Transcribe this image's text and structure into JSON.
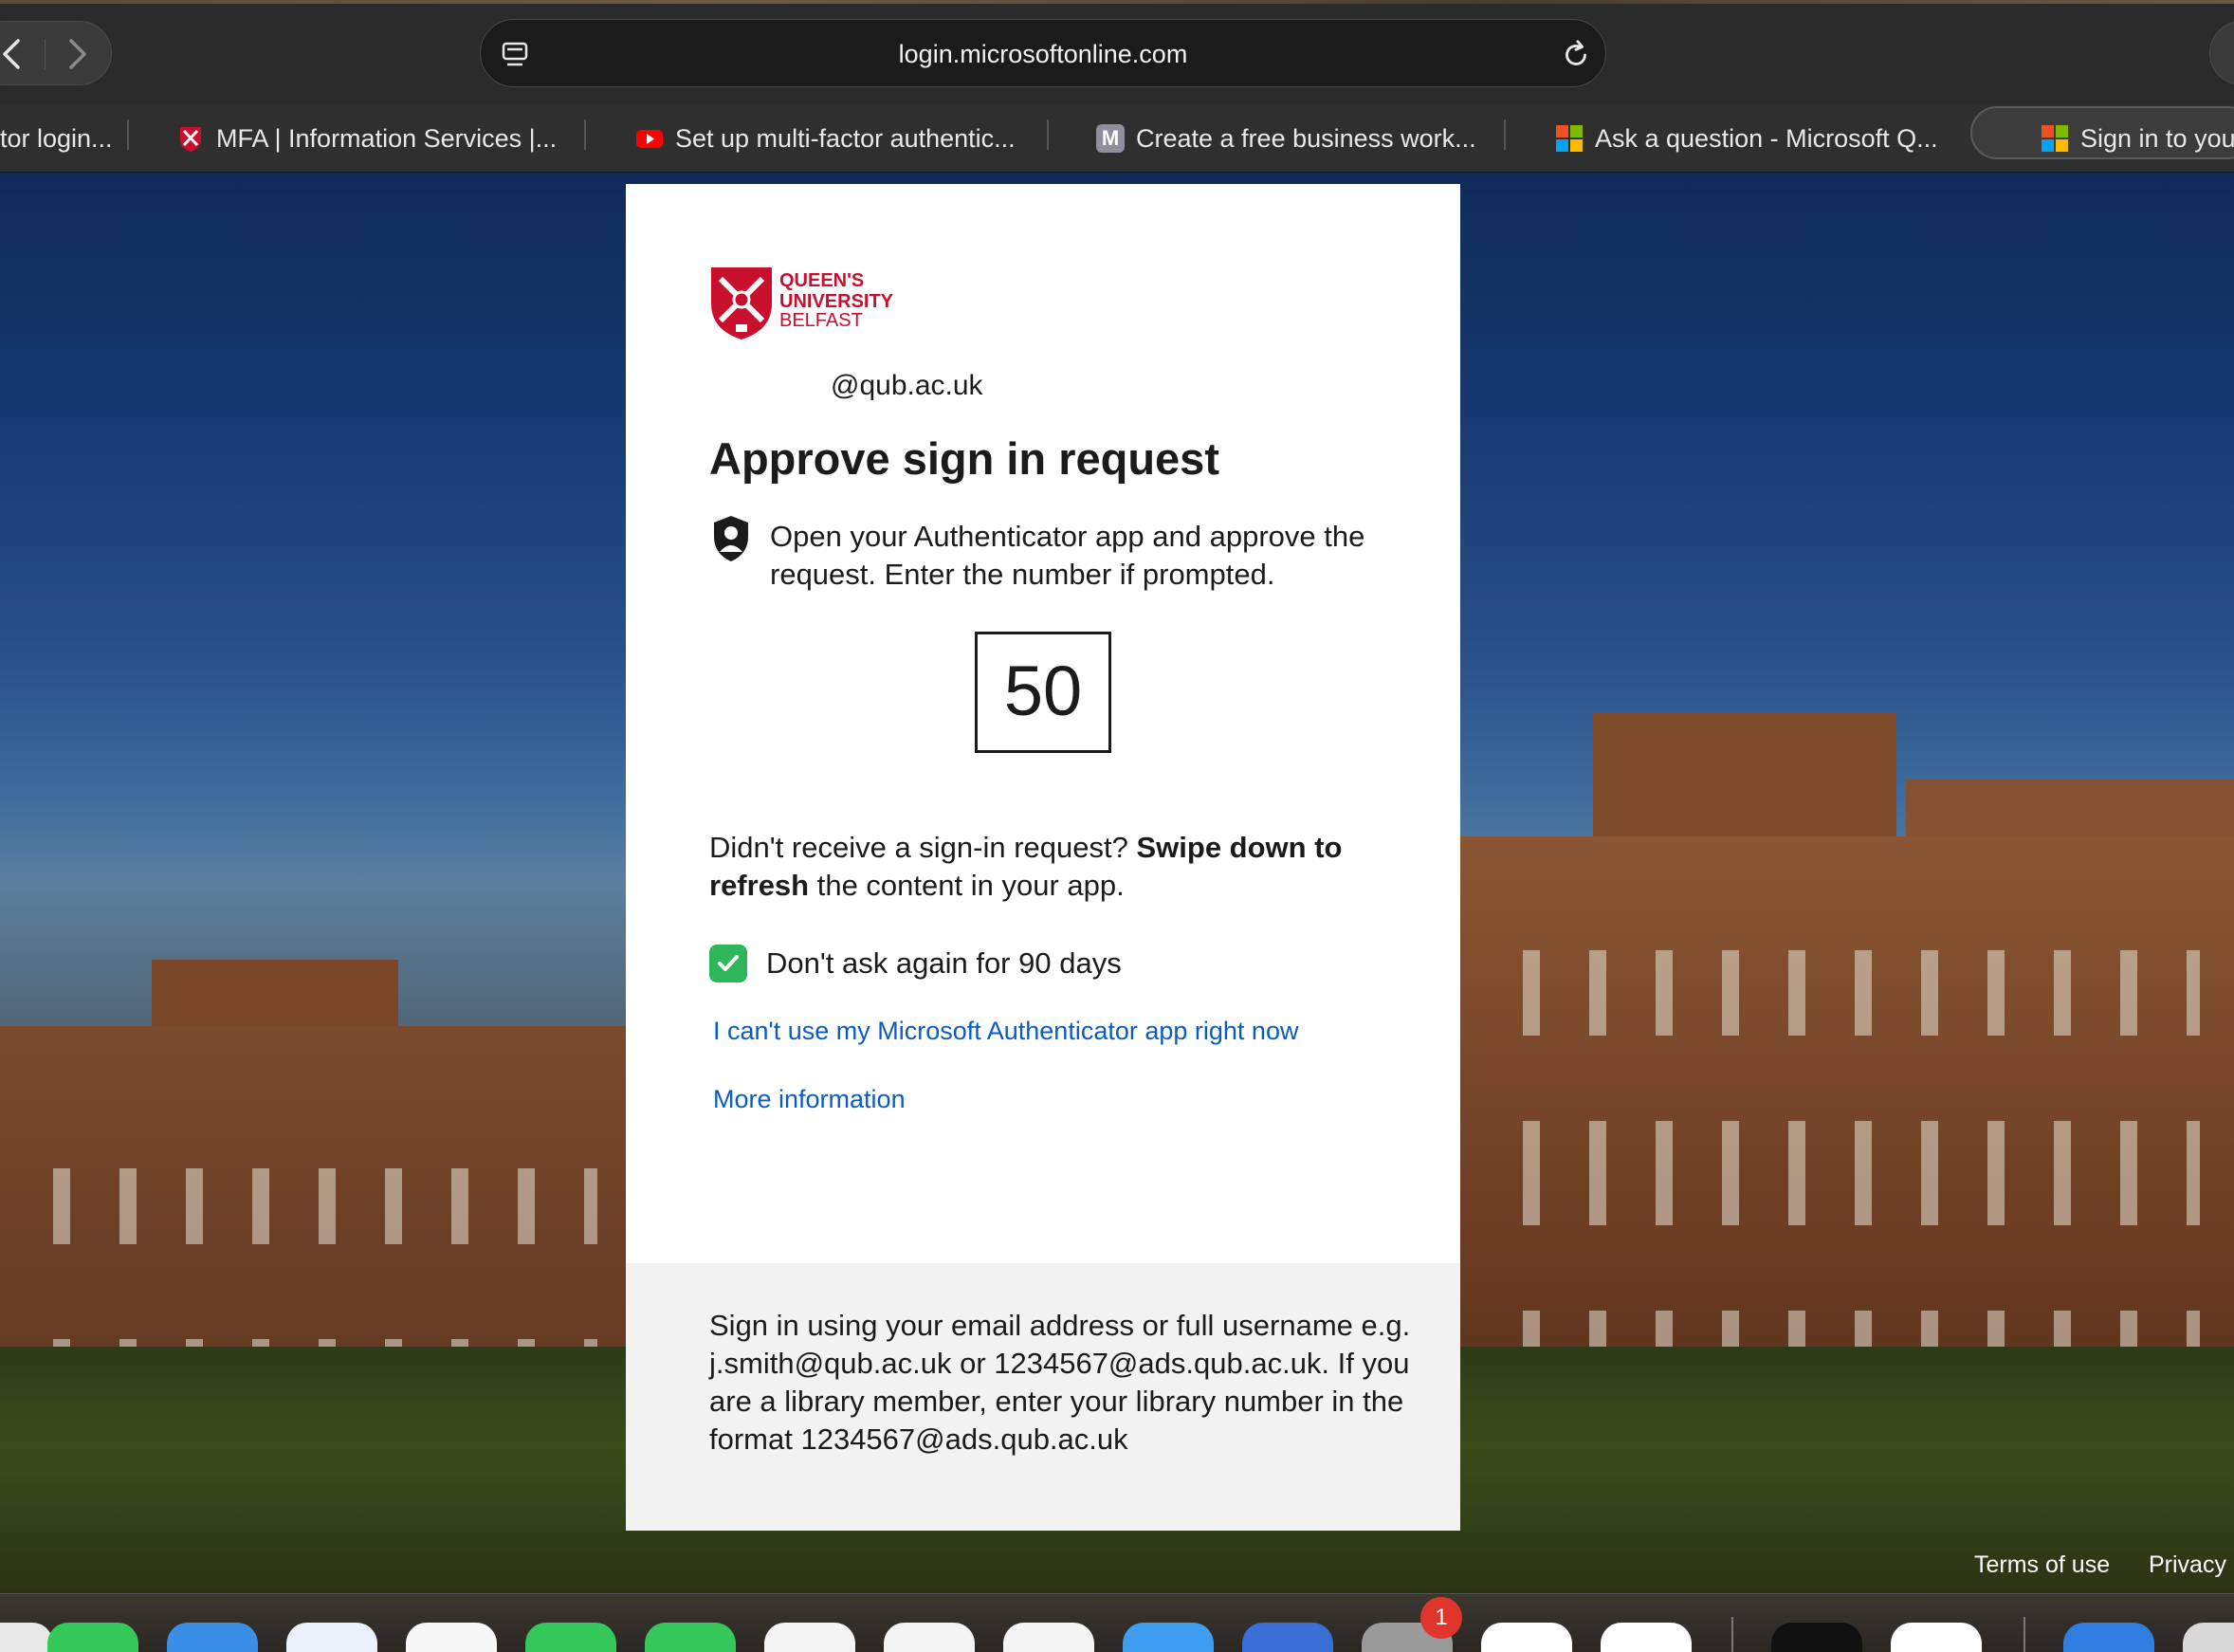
{
  "browser": {
    "url": "login.microsoftonline.com",
    "tabs": [
      {
        "label": "tor login...",
        "favicon": "none"
      },
      {
        "label": "MFA | Information Services |...",
        "favicon": "qub-crest-icon"
      },
      {
        "label": "Set up multi-factor authentic...",
        "favicon": "youtube-icon"
      },
      {
        "label": "Create a free business work...",
        "favicon": "m-letter-icon",
        "favicon_letter": "M"
      },
      {
        "label": "Ask a question - Microsoft Q...",
        "favicon": "microsoft-logo-icon"
      },
      {
        "label": "Sign in to you",
        "favicon": "microsoft-logo-icon",
        "active": true
      }
    ]
  },
  "signin": {
    "logo": {
      "line1": "QUEEN'S",
      "line2": "UNIVERSITY",
      "line3": "BELFAST",
      "color": "#c8102e"
    },
    "username": "@qub.ac.uk",
    "title": "Approve sign in request",
    "instruction": "Open your Authenticator app and approve the request. Enter the number if prompted.",
    "number": "50",
    "didnt_receive_prefix": "Didn't receive a sign-in request? ",
    "didnt_receive_bold": "Swipe down to refresh",
    "didnt_receive_suffix": " the content in your app.",
    "remember_label": "Don't ask again for 90 days",
    "remember_checked": true,
    "cant_use_link": "I can't use my Microsoft Authenticator app right now",
    "more_info_link": "More information",
    "footer_text": "Sign in using your email address or full username e.g. j.smith@qub.ac.uk or 1234567@ads.qub.ac.uk. If you are a library member, enter your library number in the format 1234567@ads.qub.ac.uk"
  },
  "page_footer": {
    "terms": "Terms of use",
    "privacy": "Privacy"
  },
  "dock": {
    "badge_count": "1"
  },
  "colors": {
    "link": "#0b5cc0",
    "check": "#2fb55a",
    "qub_red": "#c8102e"
  }
}
